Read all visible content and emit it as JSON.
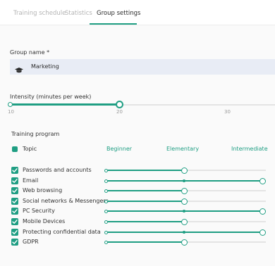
{
  "tabs": [
    {
      "label": "Training schedule",
      "active": false
    },
    {
      "label": "Statistics",
      "active": false
    },
    {
      "label": "Group settings",
      "active": true
    }
  ],
  "group_name": {
    "label": "Group name *",
    "value": "Marketing",
    "icon": "graduation-cap-icon"
  },
  "intensity": {
    "label": "Intensity (minutes per week)",
    "value": 20,
    "min": 10,
    "max": 40,
    "ticks": [
      "10",
      "20",
      "30"
    ]
  },
  "training_program": {
    "label": "Training program",
    "topic_header": "Topic",
    "levels": [
      "Beginner",
      "Elementary",
      "Intermediate"
    ],
    "rows": [
      {
        "label": "Passwords and accounts",
        "checked": true,
        "level": "Elementary"
      },
      {
        "label": "Email",
        "checked": true,
        "level": "Intermediate"
      },
      {
        "label": "Web browsing",
        "checked": true,
        "level": "Elementary"
      },
      {
        "label": "Social networks & Messengers",
        "checked": true,
        "level": "Elementary"
      },
      {
        "label": "PC Security",
        "checked": true,
        "level": "Intermediate"
      },
      {
        "label": "Mobile Devices",
        "checked": true,
        "level": "Elementary"
      },
      {
        "label": "Protecting confidential data",
        "checked": true,
        "level": "Intermediate"
      },
      {
        "label": "GDPR",
        "checked": true,
        "level": "Elementary"
      }
    ]
  },
  "colors": {
    "accent": "#1f9e83",
    "input_bg": "#e8ecf5",
    "track": "#e4e4e4"
  }
}
